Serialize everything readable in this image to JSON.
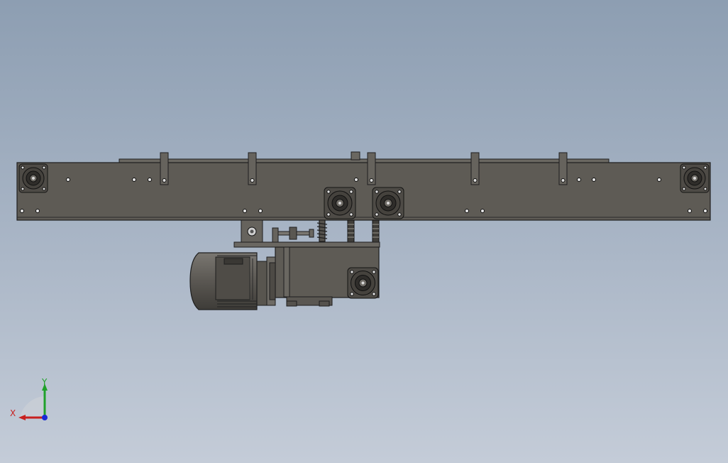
{
  "viewport": {
    "background_top": "#8d9eb2",
    "background_bottom": "#c4ccd8",
    "part_color": "#5e5b55",
    "edge_color": "#1e1e1e"
  },
  "triad": {
    "x_label": "X",
    "y_label": "Y",
    "x_color": "#c8201f",
    "y_color": "#1fa12a",
    "z_color": "#1b2bd6"
  }
}
